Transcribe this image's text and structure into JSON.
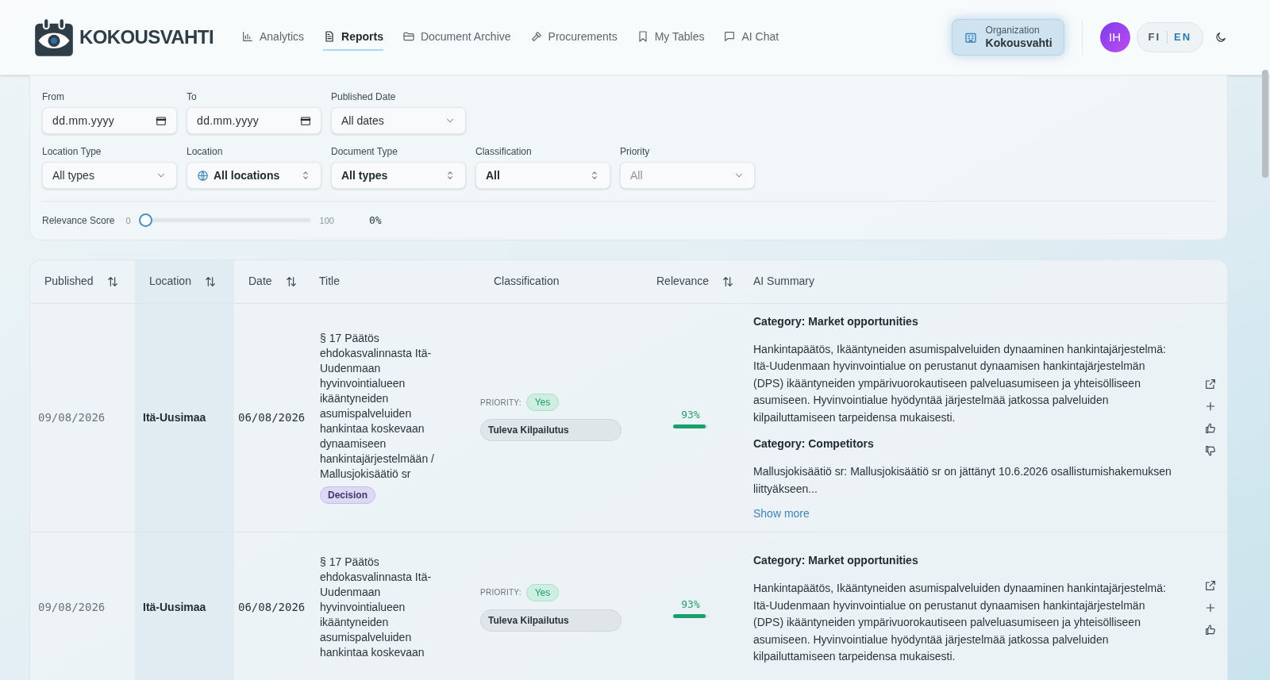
{
  "header": {
    "brand": "KOKOUSVAHTI",
    "nav_items": [
      {
        "label": "Analytics",
        "selected": false
      },
      {
        "label": "Reports",
        "selected": true
      },
      {
        "label": "Document Archive",
        "selected": false
      },
      {
        "label": "Procurements",
        "selected": false
      },
      {
        "label": "My Tables",
        "selected": false
      },
      {
        "label": "AI Chat",
        "selected": false
      }
    ],
    "organization": {
      "label": "Organization",
      "name": "Kokousvahti"
    },
    "avatar": "IH",
    "languages": [
      {
        "label": "FI",
        "selected": false
      },
      {
        "label": "EN",
        "selected": true
      }
    ]
  },
  "filters": {
    "rows": [
      [
        {
          "kind": "date",
          "label": "From",
          "placeholder": "dd.mm.yyyy"
        },
        {
          "kind": "date",
          "label": "To",
          "placeholder": "dd.mm.yyyy"
        },
        {
          "kind": "dropdown",
          "label": "Published Date",
          "value": "All dates"
        }
      ],
      [
        {
          "kind": "dropdown",
          "label": "Location Type",
          "value": "All types"
        },
        {
          "kind": "stepper",
          "label": "Location",
          "value": "All locations",
          "globe": true
        },
        {
          "kind": "stepper",
          "label": "Document Type",
          "value": "All types"
        },
        {
          "kind": "stepper",
          "label": "Classification",
          "value": "All"
        },
        {
          "kind": "dropdown",
          "label": "Priority",
          "placeholder": "All"
        }
      ]
    ],
    "relevance": {
      "label": "Relevance Score",
      "min": "0",
      "max": "100",
      "level": 0,
      "reading": "0%"
    }
  },
  "table": {
    "columns": [
      {
        "label": "Published",
        "sortable": true,
        "selected": false
      },
      {
        "label": "Location",
        "sortable": true,
        "selected": true
      },
      {
        "label": "Date",
        "sortable": true,
        "selected": false
      },
      {
        "label": "Title",
        "sortable": false,
        "selected": false
      },
      {
        "label": "Classification",
        "sortable": false,
        "selected": false
      },
      {
        "label": "Relevance",
        "sortable": true,
        "selected": false
      },
      {
        "label": "AI Summary",
        "sortable": false,
        "selected": false
      }
    ],
    "rows": [
      {
        "published": "09/08/2026",
        "location": "Itä-Uusimaa",
        "date": "06/08/2026",
        "title": "§ 17 Päätös ehdokasvalinnasta Itä-Uudenmaan hyvinvointialueen ikääntyneiden asumispalveluiden hankintaa koskevaan dynaamiseen hankintajärjestelmään / Mallusjokisäätiö sr",
        "tag": "Decision",
        "priority_label": "PRIORITY:",
        "priority": "Yes",
        "classification": "Tuleva Kilpailutus",
        "relevance": "93%",
        "level": 0.93,
        "summary": [
          {
            "heading": "Category: Market opportunities",
            "text": "Hankintapäätös, Ikääntyneiden asumispalveluiden dynaaminen hankintajärjestelmä: Itä-Uudenmaan hyvinvointialue on perustanut dynaamisen hankintajärjestelmän (DPS) ikääntyneiden ympärivuorokautiseen palveluasumiseen ja yhteisölliseen asumiseen. Hyvinvointialue hyödyntää järjestelmää jatkossa palveluiden kilpailuttamiseen tarpeidensa mukaisesti."
          },
          {
            "heading": "Category: Competitors",
            "text": "Mallusjokisäätiö sr: Mallusjokisäätiö sr on jättänyt 10.6.2026 osallistumishakemuksen liittyäkseen..."
          }
        ],
        "show_more": "Show more"
      },
      {
        "published": "09/08/2026",
        "location": "Itä-Uusimaa",
        "date": "06/08/2026",
        "title": "§ 17 Päätös ehdokasvalinnasta Itä-Uudenmaan hyvinvointialueen ikääntyneiden asumispalveluiden hankintaa koskevaan",
        "priority_label": "PRIORITY:",
        "priority": "Yes",
        "classification": "Tuleva Kilpailutus",
        "relevance": "93%",
        "level": 0.93,
        "summary": [
          {
            "heading": "Category: Market opportunities",
            "text": "Hankintapäätös, Ikääntyneiden asumispalveluiden dynaaminen hankintajärjestelmä: Itä-Uudenmaan hyvinvointialue on perustanut dynaamisen hankintajärjestelmän (DPS) ikääntyneiden ympärivuorokautiseen palveluasumiseen ja yhteisölliseen asumiseen. Hyvinvointialue hyödyntää järjestelmää jatkossa palveluiden kilpailuttamiseen tarpeidensa mukaisesti."
          }
        ]
      }
    ]
  }
}
